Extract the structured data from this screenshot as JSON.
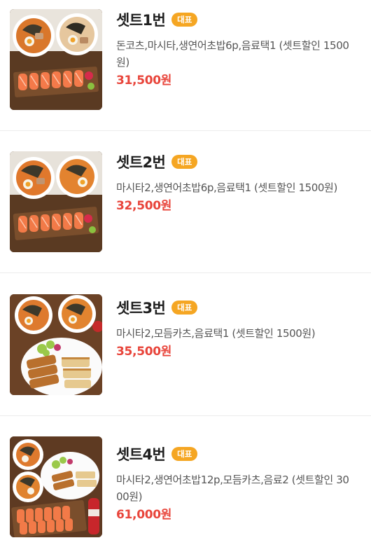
{
  "menu": {
    "items": [
      {
        "name": "셋트1번",
        "badge": "대표",
        "description": "돈코츠,마시타,생연어초밥6p,음료택1 (셋트할인 1500원)",
        "price": "31,500원",
        "photo": "ramen-two-bowls-salmon-sushi-photo"
      },
      {
        "name": "셋트2번",
        "badge": "대표",
        "description": "마시타2,생연어초밥6p,음료택1 (셋트할인 1500원)",
        "price": "32,500원",
        "photo": "ramen-two-bowls-salmon-sushi-photo"
      },
      {
        "name": "셋트3번",
        "badge": "대표",
        "description": "마시타2,모듬카츠,음료택1 (셋트할인 1500원)",
        "price": "35,500원",
        "photo": "ramen-two-bowls-katsu-plate-photo"
      },
      {
        "name": "셋트4번",
        "badge": "대표",
        "description": "마시타2,생연어초밥12p,모듬카츠,음료2 (셋트할인 3000원)",
        "price": "61,000원",
        "photo": "ramen-katsu-salmon-sushi-photo"
      }
    ]
  },
  "colors": {
    "badge_background": "#f5a623",
    "price": "#e8443a",
    "divider": "#ececec"
  }
}
